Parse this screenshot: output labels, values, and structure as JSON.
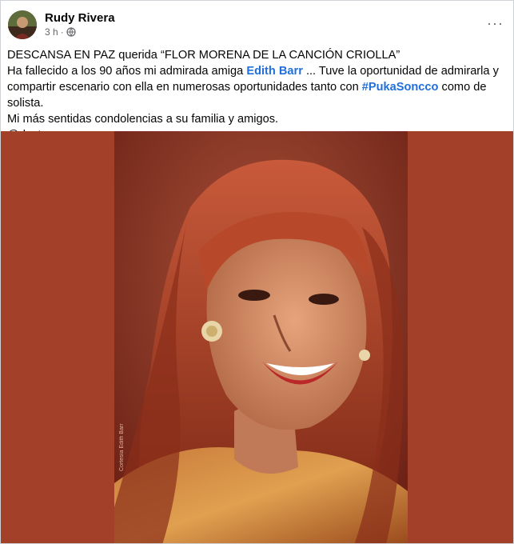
{
  "post": {
    "author": "Rudy Rivera",
    "timestamp": "3 h",
    "separator": "·",
    "privacy_icon": "globe-icon",
    "more_icon": "more-options-icon",
    "more_label": "···",
    "text": {
      "line1": "DESCANSA EN PAZ querida “FLOR MORENA DE LA CANCIÓN CRIOLLA”",
      "line2_pre": "Ha fallecido a los 90 años mi admirada amiga ",
      "mention": "Edith Barr",
      "line2_post": " ... Tuve la oportunidad de admirarla y compartir escenario con ella en numerosas oportunidades tanto con ",
      "hashtag": "#PukaSoncco",
      "line3_post": " como de solista.",
      "line4": "Mi más sentidas condolencias a su familia y amigos.",
      "line5": "@destacar"
    },
    "photo": {
      "subject": "portrait-of-smiling-woman",
      "credit": "Cortesía Edith Barr"
    }
  },
  "colors": {
    "link": "#216fdb",
    "photo_background": "#a3402a",
    "meta_text": "#65676b"
  }
}
